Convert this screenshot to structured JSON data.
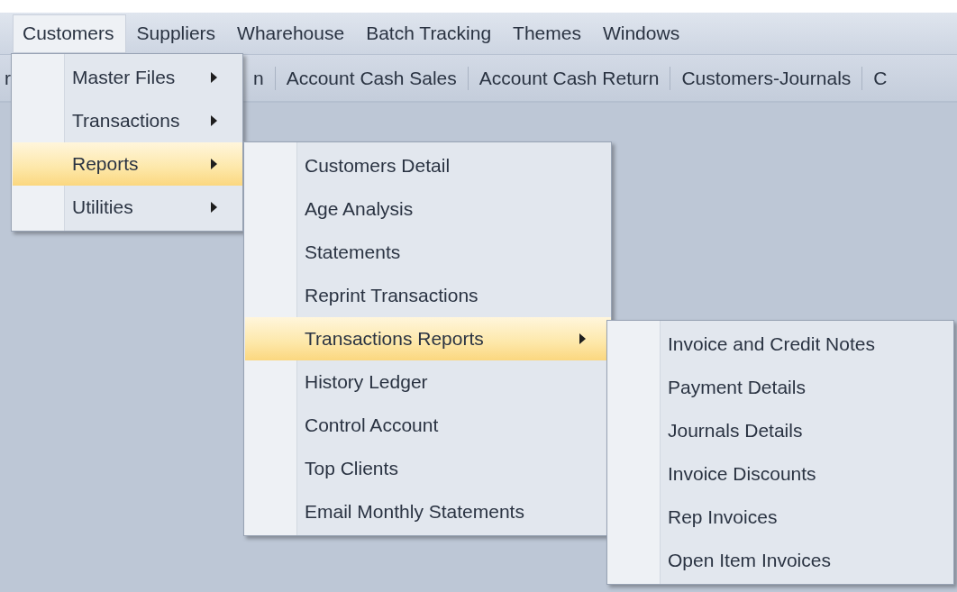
{
  "menubar": {
    "items": [
      {
        "label": "Customers",
        "selected": true,
        "children": [
          {
            "label": "Master Files",
            "submenu": true,
            "selected": false
          },
          {
            "label": "Transactions",
            "submenu": true,
            "selected": false
          },
          {
            "label": "Reports",
            "submenu": true,
            "selected": true,
            "children": [
              {
                "label": "Customers Detail",
                "submenu": false,
                "selected": false
              },
              {
                "label": "Age Analysis",
                "submenu": false,
                "selected": false
              },
              {
                "label": "Statements",
                "submenu": false,
                "selected": false
              },
              {
                "label": "Reprint Transactions",
                "submenu": false,
                "selected": false
              },
              {
                "label": "Transactions Reports",
                "submenu": true,
                "selected": true,
                "children": [
                  {
                    "label": "Invoice and Credit Notes",
                    "submenu": false,
                    "selected": false
                  },
                  {
                    "label": "Payment Details",
                    "submenu": false,
                    "selected": false
                  },
                  {
                    "label": "Journals Details",
                    "submenu": false,
                    "selected": false
                  },
                  {
                    "label": "Invoice Discounts",
                    "submenu": false,
                    "selected": false
                  },
                  {
                    "label": "Rep Invoices",
                    "submenu": false,
                    "selected": false
                  },
                  {
                    "label": "Open Item Invoices",
                    "submenu": false,
                    "selected": false
                  }
                ]
              },
              {
                "label": "History Ledger",
                "submenu": false,
                "selected": false
              },
              {
                "label": "Control Account",
                "submenu": false,
                "selected": false
              },
              {
                "label": "Top Clients",
                "submenu": false,
                "selected": false
              },
              {
                "label": "Email Monthly Statements",
                "submenu": false,
                "selected": false
              }
            ]
          },
          {
            "label": "Utilities",
            "submenu": true,
            "selected": false
          }
        ]
      },
      {
        "label": "Suppliers",
        "selected": false
      },
      {
        "label": "Wharehouse",
        "selected": false
      },
      {
        "label": "Batch Tracking",
        "selected": false
      },
      {
        "label": "Themes",
        "selected": false
      },
      {
        "label": "Windows",
        "selected": false
      }
    ]
  },
  "toolbar": {
    "items": [
      "r",
      "n",
      "Account Cash Sales",
      "Account Cash Return",
      "Customers-Journals",
      "C"
    ]
  }
}
